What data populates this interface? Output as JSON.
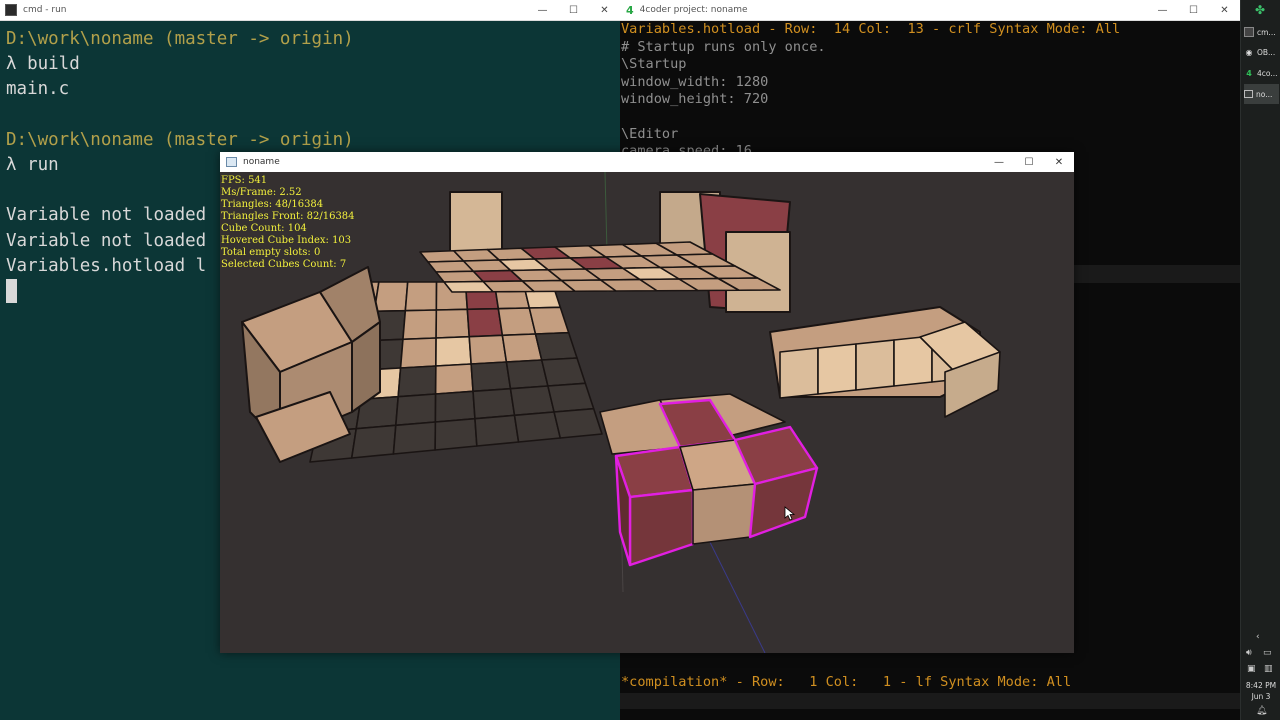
{
  "cmd_window": {
    "title": "cmd - run",
    "lines": [
      {
        "text": "D:\\work\\noname (master -> origin)",
        "kind": "prompt"
      },
      {
        "text": "λ build",
        "kind": "out"
      },
      {
        "text": "main.c",
        "kind": "out"
      },
      {
        "text": "",
        "kind": "out"
      },
      {
        "text": "D:\\work\\noname (master -> origin)",
        "kind": "prompt"
      },
      {
        "text": "λ run",
        "kind": "out"
      },
      {
        "text": "",
        "kind": "out"
      },
      {
        "text": "Variable not loaded",
        "kind": "out"
      },
      {
        "text": "Variable not loaded",
        "kind": "out"
      },
      {
        "text": "Variables.hotload l",
        "kind": "out"
      }
    ]
  },
  "coder_window": {
    "title": "4coder project: noname",
    "status_top": "Variables.hotload - Row:  14 Col:  13 - crlf Syntax Mode: All",
    "code_lines": [
      "# Startup runs only once.",
      "\\Startup",
      "window_width: 1280",
      "window_height: 720",
      "",
      "\\Editor",
      "camera_speed: 16"
    ],
    "status_bottom": "*compilation* - Row:   1 Col:   1 - lf Syntax Mode: All"
  },
  "game_window": {
    "title": "noname",
    "hud": [
      "FPS: 541",
      "Ms/Frame: 2.52",
      "Triangles: 48/16384",
      "Triangles Front: 82/16384",
      "Cube Count: 104",
      "Hovered Cube Index: 103",
      "Total empty slots: 0",
      "Selected Cubes Count: 7"
    ]
  },
  "taskbar": {
    "items": [
      {
        "label": "cm...",
        "icon": "terminal-icon"
      },
      {
        "label": "OB...",
        "icon": "obs-icon"
      },
      {
        "label": "4co...",
        "icon": "4coder-icon"
      },
      {
        "label": "no...",
        "icon": "app-window-icon"
      }
    ],
    "time": "8:42 PM",
    "date": "Jun 3"
  },
  "colors": {
    "cube_top": "#c49e80",
    "cube_light": "#e6c7a3",
    "cube_dark": "#3e3835",
    "cube_red": "#8a3f45",
    "selection": "#e11fe1"
  }
}
